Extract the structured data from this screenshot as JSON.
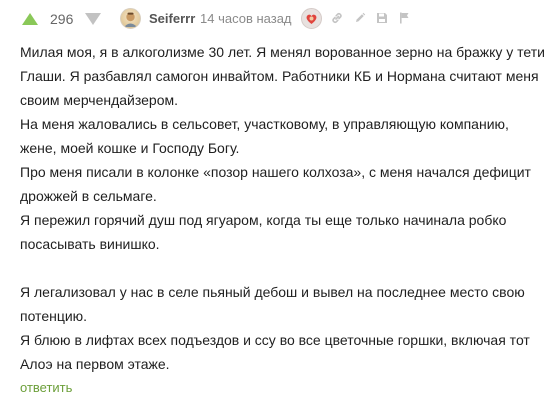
{
  "comment": {
    "rating": "296",
    "username": "Seiferrr",
    "timestamp": "14 часов назад",
    "paragraphs": [
      "Милая моя, я в алкоголизме 30 лет. Я менял ворованное зерно на бражку у тети Глаши. Я разбавлял самогон инвайтом. Работники КБ и Нормана считают меня своим мерчендайзером.",
      "На меня жаловались в сельсовет, участковому, в управляющую компанию, жене, моей кошке и Господу Богу.",
      "Про меня писали в колонке «позор нашего колхоза», с меня начался дефицит дрожжей в сельмаге.",
      "Я пережил горячий душ под ягуаром, когда ты еще только начинала робко посасывать винишко.",
      "",
      "Я легализовал у нас в селе пьяный дебош и вывел на последнее место свою потенцию.",
      "Я блюю в лифтах всех подъездов и ссу во все цветочные горшки, включая тот Алоэ на первом этаже."
    ],
    "reply_label": "ответить"
  },
  "icons": {
    "vote_up": "arrow-up-icon",
    "vote_down": "arrow-down-icon",
    "avatar": "user-avatar",
    "badge": "author-badge",
    "link": "link-icon",
    "pencil": "pencil-icon",
    "save": "save-icon",
    "report": "flag-icon"
  },
  "colors": {
    "vote_up": "#8ac858",
    "vote_down": "#c2c2c2",
    "reply_link": "#6c9f3a",
    "timestamp": "#8a8a8a",
    "text": "#1f1f1f"
  }
}
